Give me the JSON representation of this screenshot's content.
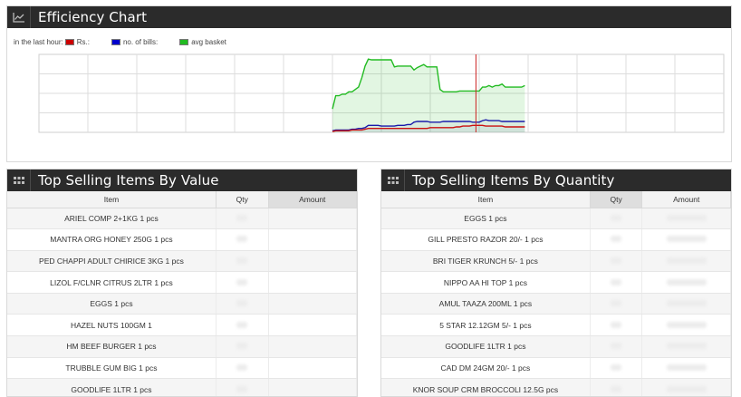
{
  "efficiency": {
    "title": "Efficiency Chart",
    "icon": "line-chart-icon",
    "legend_prefix": "in the last hour:",
    "legend": [
      {
        "label": "Rs.:",
        "color": "#cc0000"
      },
      {
        "label": "no. of bills:",
        "color": "#0000cc"
      },
      {
        "label": "avg basket",
        "color": "#22bb22"
      }
    ]
  },
  "chart_data": {
    "type": "line",
    "title": "",
    "xlabel": "",
    "ylabel": "",
    "grid": true,
    "x": [
      0,
      1,
      2,
      3,
      4,
      5,
      6,
      7,
      8,
      9,
      10,
      11,
      12,
      13,
      14,
      15,
      16,
      17,
      18,
      19,
      20,
      21,
      22,
      23,
      24,
      25,
      26,
      27,
      28,
      29,
      30,
      31,
      32,
      33,
      34,
      35,
      36,
      37,
      38,
      39,
      40,
      41,
      42,
      43,
      44,
      45,
      46,
      47,
      48,
      49,
      50,
      51,
      52,
      53,
      54,
      55,
      56,
      57,
      58,
      59
    ],
    "xlim": [
      0,
      210
    ],
    "ylim": [
      0,
      100
    ],
    "marker_x": 44,
    "series": [
      {
        "name": "avg basket",
        "color": "#22bb22",
        "values": [
          30,
          47,
          47,
          49,
          49,
          52,
          52,
          55,
          58,
          70,
          85,
          94,
          93,
          93,
          93,
          93,
          93,
          93,
          93,
          84,
          85,
          85,
          85,
          85,
          85,
          80,
          83,
          85,
          87,
          84,
          84,
          84,
          84,
          55,
          52,
          52,
          52,
          52,
          52,
          53,
          53,
          53,
          53,
          53,
          53,
          53,
          58,
          58,
          60,
          58,
          60,
          60,
          62,
          58,
          58,
          58,
          58,
          58,
          58,
          60
        ]
      },
      {
        "name": "no. of bills:",
        "color": "#1a1aaa",
        "values": [
          2,
          3,
          3,
          3,
          3,
          3,
          4,
          4,
          5,
          5,
          6,
          9,
          9,
          9,
          9,
          8,
          8,
          8,
          8,
          8,
          9,
          9,
          9,
          10,
          10,
          13,
          14,
          14,
          14,
          14,
          13,
          13,
          13,
          13,
          14,
          14,
          14,
          14,
          14,
          14,
          14,
          14,
          14,
          13,
          13,
          13,
          15,
          16,
          15,
          15,
          15,
          15,
          14,
          14,
          14,
          14,
          14,
          14,
          14,
          14
        ]
      },
      {
        "name": "Rs.:",
        "color": "#cc1111",
        "values": [
          1,
          2,
          2,
          2,
          2,
          2,
          3,
          3,
          3,
          3,
          4,
          5,
          5,
          5,
          5,
          5,
          5,
          5,
          5,
          5,
          5,
          5,
          5,
          5,
          5,
          5,
          5,
          5,
          5,
          5,
          6,
          6,
          6,
          6,
          6,
          6,
          6,
          6,
          7,
          7,
          8,
          8,
          8,
          9,
          9,
          9,
          9,
          8,
          8,
          8,
          8,
          8,
          8,
          7,
          7,
          7,
          7,
          7,
          7,
          7
        ]
      }
    ]
  },
  "top_value": {
    "title": "Top Selling Items By Value",
    "icon": "grid-icon",
    "columns": [
      "Item",
      "Qty",
      "Amount"
    ],
    "rows": [
      "ARIEL COMP 2+1KG 1 pcs",
      "MANTRA ORG HONEY 250G 1 pcs",
      "PED CHAPPI ADULT CHIRICE 3KG 1 pcs",
      "LIZOL F/CLNR CITRUS 2LTR 1 pcs",
      "EGGS 1 pcs",
      "HAZEL NUTS 100GM 1",
      "HM BEEF BURGER 1 pcs",
      "TRUBBLE GUM BIG 1 pcs",
      "GOODLIFE 1LTR 1 pcs"
    ]
  },
  "top_qty": {
    "title": "Top Selling Items By Quantity",
    "icon": "grid-icon",
    "columns": [
      "Item",
      "Qty",
      "Amount"
    ],
    "rows": [
      "EGGS 1 pcs",
      "GILL PRESTO RAZOR 20/- 1 pcs",
      "BRI TIGER KRUNCH 5/- 1 pcs",
      "NIPPO AA HI TOP 1 pcs",
      "AMUL TAAZA 200ML 1 pcs",
      "5 STAR 12.12GM 5/- 1 pcs",
      "GOODLIFE 1LTR 1 pcs",
      "CAD DM 24GM 20/- 1 pcs",
      "KNOR SOUP CRM BROCCOLI 12.5G pcs"
    ]
  }
}
